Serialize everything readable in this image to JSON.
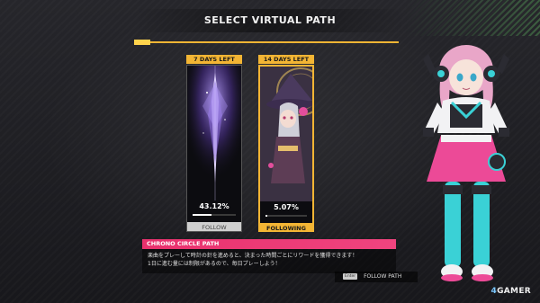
{
  "header": {
    "title": "SELECT VIRTUAL PATH"
  },
  "paths": [
    {
      "days_left": "7 DAYS LEFT",
      "percent": "43.12%",
      "progress": 0.4312,
      "button": "FOLLOW",
      "selected": false
    },
    {
      "days_left": "14 DAYS LEFT",
      "percent": "5.07%",
      "progress": 0.0507,
      "button": "FOLLOWING",
      "selected": true
    }
  ],
  "info": {
    "title": "CHRONO CIRCLE PATH",
    "line1": "楽曲をプレーして時計の針を進めると、決まった時間ごとにリワードを獲得できます！",
    "line2": "1日に進む量には制限があるので、毎日プレーしよう！"
  },
  "footer": {
    "key_label": "Enter",
    "action_label": "FOLLOW PATH"
  },
  "watermark": {
    "mark": "4",
    "text": "GAMER"
  },
  "colors": {
    "accent": "#f3b534",
    "highlight": "#e8316d"
  }
}
